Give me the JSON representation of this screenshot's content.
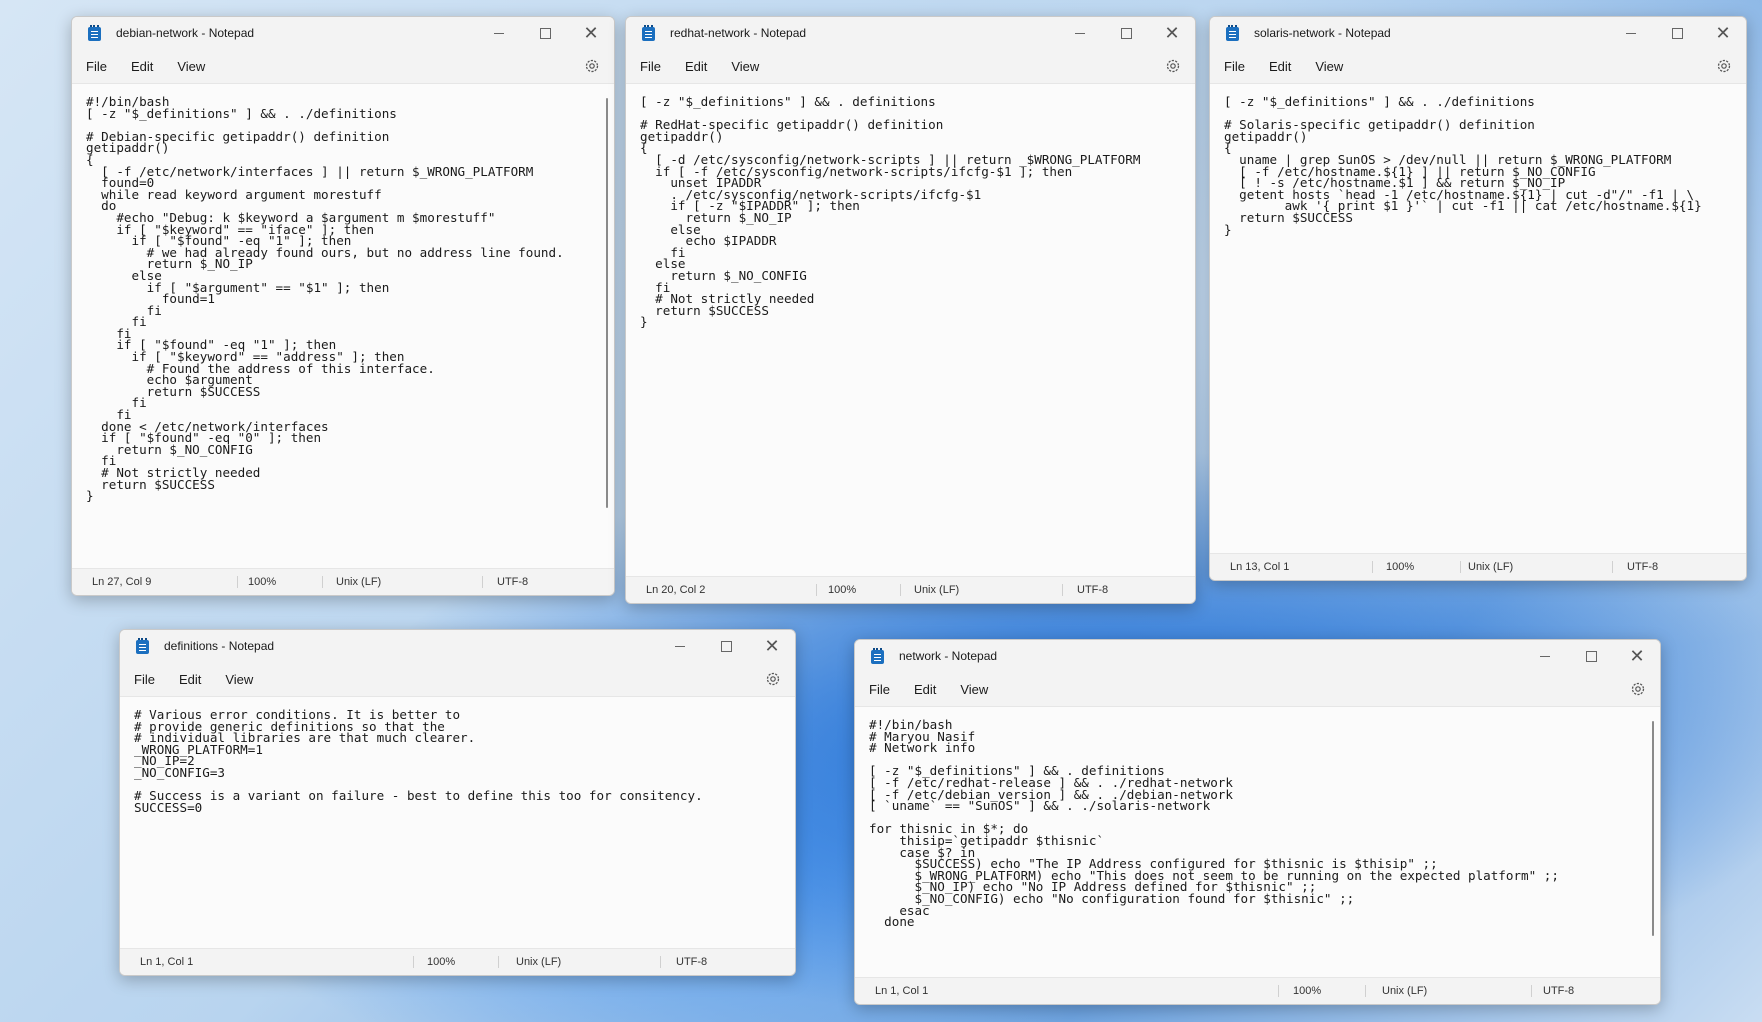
{
  "menu": {
    "file": "File",
    "edit": "Edit",
    "view": "View"
  },
  "windows": {
    "debian": {
      "title": "debian-network - Notepad",
      "code": "#!/bin/bash\n[ -z \"$_definitions\" ] && . ./definitions\n\n# Debian-specific getipaddr() definition\ngetipaddr()\n{\n  [ -f /etc/network/interfaces ] || return $_WRONG_PLATFORM\n  found=0\n  while read keyword argument morestuff\n  do\n    #echo \"Debug: k $keyword a $argument m $morestuff\"\n    if [ \"$keyword\" == \"iface\" ]; then\n      if [ \"$found\" -eq \"1\" ]; then\n        # we had already found ours, but no address line found.\n        return $_NO_IP\n      else\n        if [ \"$argument\" == \"$1\" ]; then\n          found=1\n        fi\n      fi\n    fi\n    if [ \"$found\" -eq \"1\" ]; then\n      if [ \"$keyword\" == \"address\" ]; then\n        # Found the address of this interface.\n        echo $argument\n        return $SUCCESS\n      fi\n    fi\n  done < /etc/network/interfaces\n  if [ \"$found\" -eq \"0\" ]; then\n    return $_NO_CONFIG\n  fi\n  # Not strictly needed\n  return $SUCCESS\n}",
      "status": {
        "pos": "Ln 27, Col 9",
        "zoom": "100%",
        "eol": "Unix (LF)",
        "enc": "UTF-8"
      }
    },
    "redhat": {
      "title": "redhat-network - Notepad",
      "code": "[ -z \"$_definitions\" ] && . definitions\n\n# RedHat-specific getipaddr() definition\ngetipaddr()\n{\n  [ -d /etc/sysconfig/network-scripts ] || return _$WRONG_PLATFORM\n  if [ -f /etc/sysconfig/network-scripts/ifcfg-$1 ]; then\n    unset IPADDR\n    . /etc/sysconfig/network-scripts/ifcfg-$1\n    if [ -z \"$IPADDR\" ]; then\n      return $_NO_IP\n    else\n      echo $IPADDR\n    fi\n  else\n    return $_NO_CONFIG\n  fi\n  # Not strictly needed\n  return $SUCCESS\n}",
      "status": {
        "pos": "Ln 20, Col 2",
        "zoom": "100%",
        "eol": "Unix (LF)",
        "enc": "UTF-8"
      }
    },
    "solaris": {
      "title": "solaris-network - Notepad",
      "code": "[ -z \"$_definitions\" ] && . ./definitions\n\n# Solaris-specific getipaddr() definition\ngetipaddr()\n{\n  uname | grep SunOS > /dev/null || return $_WRONG_PLATFORM\n  [ -f /etc/hostname.${1} ] || return $_NO_CONFIG\n  [ ! -s /etc/hostname.$1 ] && return $_NO_IP\n  getent hosts `head -1 /etc/hostname.${1} | cut -d\"/\" -f1 | \\\n        awk '{ print $1 }'` | cut -f1 || cat /etc/hostname.${1}\n  return $SUCCESS\n}",
      "status": {
        "pos": "Ln 13, Col 1",
        "zoom": "100%",
        "eol": "Unix (LF)",
        "enc": "UTF-8"
      }
    },
    "definitions": {
      "title": "definitions - Notepad",
      "code": "# Various error conditions. It is better to\n# provide generic definitions so that the\n# individual libraries are that much clearer.\n_WRONG_PLATFORM=1\n_NO_IP=2\n_NO_CONFIG=3\n\n# Success is a variant on failure - best to define this too for consitency.\nSUCCESS=0",
      "status": {
        "pos": "Ln 1, Col 1",
        "zoom": "100%",
        "eol": "Unix (LF)",
        "enc": "UTF-8"
      }
    },
    "network": {
      "title": "network - Notepad",
      "code": "#!/bin/bash\n# Maryou Nasif\n# Network info\n\n[ -z \"$_definitions\" ] && . definitions\n[ -f /etc/redhat-release ] && . ./redhat-network\n[ -f /etc/debian_version ] && . ./debian-network\n[ `uname` == \"SunOS\" ] && . ./solaris-network\n\nfor thisnic in $*; do\n    thisip=`getipaddr $thisnic`\n    case $? in\n      $SUCCESS) echo \"The IP Address configured for $thisnic is $thisip\" ;;\n      $_WRONG_PLATFORM) echo \"This does not seem to be running on the expected platform\" ;;\n      $_NO_IP) echo \"No IP Address defined for $thisnic\" ;;\n      $_NO_CONFIG) echo \"No configuration found for $thisnic\" ;;\n    esac\n  done",
      "status": {
        "pos": "Ln 1, Col 1",
        "zoom": "100%",
        "eol": "Unix (LF)",
        "enc": "UTF-8"
      }
    }
  }
}
